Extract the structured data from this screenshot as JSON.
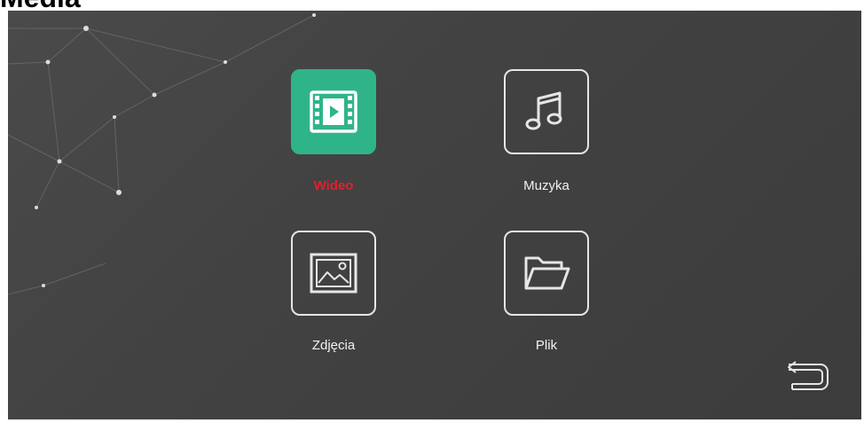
{
  "page": {
    "title": "Media"
  },
  "menu": {
    "items": [
      {
        "label": "Wideo",
        "icon": "video-icon",
        "active": true
      },
      {
        "label": "Muzyka",
        "icon": "music-note-icon",
        "active": false
      },
      {
        "label": "Zdjęcia",
        "icon": "picture-icon",
        "active": false
      },
      {
        "label": "Plik",
        "icon": "folder-icon",
        "active": false
      }
    ]
  },
  "nav": {
    "back_icon": "return-arrow-icon"
  },
  "colors": {
    "screen_background": "#444444",
    "active_tile": "#2fb48a",
    "active_label": "#e0202a",
    "inactive_label": "#f2f2f2",
    "tile_border": "#e6e6e6"
  }
}
